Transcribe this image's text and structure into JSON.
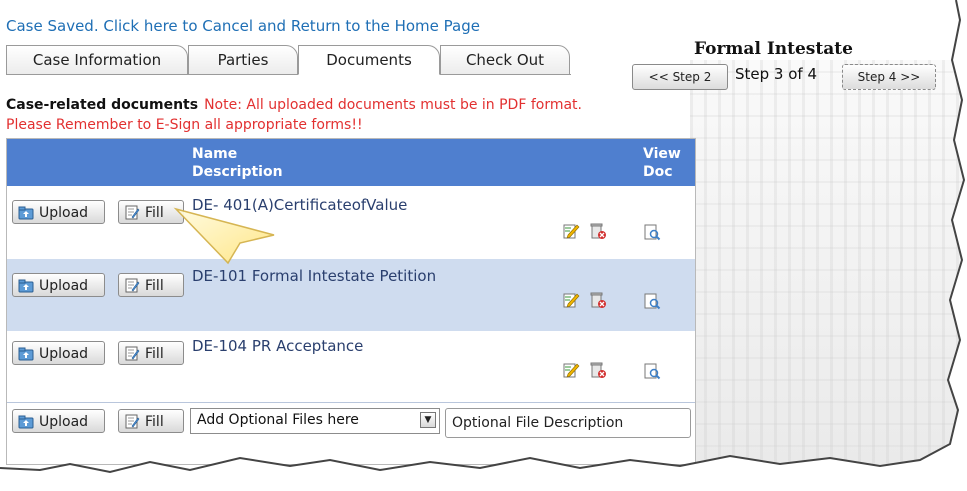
{
  "notice": {
    "case_saved_link": "Case Saved. Click here to Cancel and Return to the Home Page"
  },
  "tabs": [
    {
      "label": "Case Information",
      "active": false
    },
    {
      "label": "Parties",
      "active": false
    },
    {
      "label": "Documents",
      "active": true
    },
    {
      "label": "Check Out",
      "active": false
    }
  ],
  "wizard": {
    "title": "Formal Intestate",
    "prev_label": "<< Step 2",
    "step_text": "Step 3 of 4",
    "next_label": "Step 4 >>"
  },
  "section": {
    "heading": "Case-related documents",
    "note": "Note: All uploaded documents must be in PDF format.",
    "esign_reminder": "Please Remember to E-Sign all appropriate forms!!"
  },
  "grid": {
    "header_name": "Name",
    "header_description": "Description",
    "header_view": "View",
    "header_doc": "Doc",
    "upload_label": "Upload",
    "fill_label": "Fill",
    "rows": [
      {
        "name": "DE- 401(A)CertificateofValue"
      },
      {
        "name": "DE-101 Formal Intestate Petition"
      },
      {
        "name": "DE-104 PR Acceptance"
      }
    ],
    "optional": {
      "select_value": "Add Optional Files here",
      "description_value": "Optional File Description"
    }
  },
  "colors": {
    "header_blue": "#4f7fcf",
    "alt_row": "#cfdcef",
    "note_red": "#e23030",
    "link_blue": "#1f6fb5",
    "callout_yellow": "#fff3a8"
  },
  "icons": [
    "upload-icon",
    "fill-form-icon",
    "edit-icon",
    "delete-icon",
    "view-doc-icon",
    "chevron-down-icon",
    "callout-pointer"
  ]
}
